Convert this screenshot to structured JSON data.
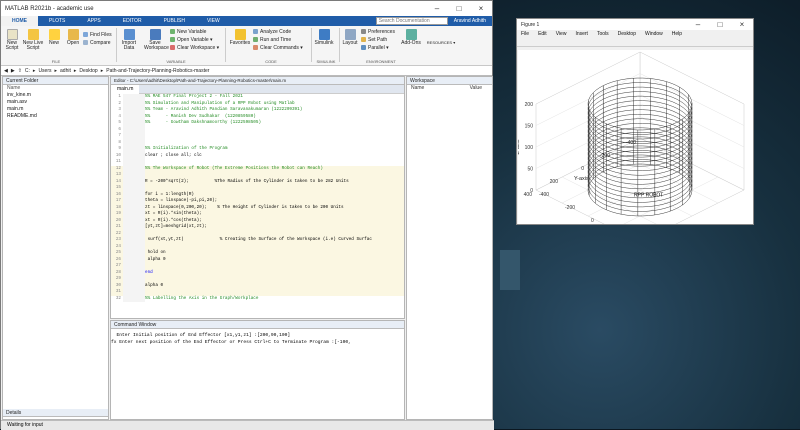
{
  "window": {
    "title": "MATLAB R2021b - academic use"
  },
  "ribbon_tabs": [
    "HOME",
    "PLOTS",
    "APPS",
    "EDITOR",
    "PUBLISH",
    "VIEW"
  ],
  "search": {
    "placeholder": "Search Documentation"
  },
  "user": "Aravind Adhith",
  "home": {
    "buttons": {
      "new_script": "New Script",
      "new_live_script": "New Live Script",
      "new": "New",
      "open": "Open",
      "find_files": "Find Files",
      "compare": "Compare",
      "import_data": "Import Data",
      "save_workspace": "Save Workspace",
      "new_variable": "New Variable",
      "open_variable": "Open Variable",
      "clear_workspace": "Clear Workspace",
      "favorites": "Favorites",
      "analyze_code": "Analyze Code",
      "run_and_time": "Run and Time",
      "clear_commands": "Clear Commands",
      "simulink": "Simulink",
      "layout": "Layout",
      "preferences": "Preferences",
      "set_path": "Set Path",
      "parallel": "Parallel",
      "add_ons": "Add-Ons",
      "resources": "RESOURCES"
    },
    "sections": {
      "file": "FILE",
      "variable": "VARIABLE",
      "code": "CODE",
      "simulink": "SIMULINK",
      "environment": "ENVIRONMENT"
    }
  },
  "address": {
    "parts": [
      "C:",
      "Users",
      "adhit",
      "Desktop",
      "Path-and-Trajectory-Planning-Robotics-master"
    ]
  },
  "current_folder": {
    "title": "Current Folder",
    "col": "Name",
    "files": [
      "inv_kine.m",
      "main.asv",
      "main.m",
      "README.md"
    ]
  },
  "details": "Details",
  "editor": {
    "title": "Editor - C:\\Users\\adhit\\Desktop\\Path-and-Trajectory-Planning-Robotics-master\\main.m",
    "tab": "main.m",
    "lines": [
      {
        "n": "1",
        "t": "%% MAE 547 Final Project 2 - Fall 2021",
        "c": "cm"
      },
      {
        "n": "2",
        "t": "%% Simulation and Manipulation of a RPP Robot using Matlab",
        "c": "cm"
      },
      {
        "n": "3",
        "t": "%% Team - Aravind Adhith Pandian Saravanakumaran (1222209391)",
        "c": "cm"
      },
      {
        "n": "4",
        "t": "%%      - Manish Dev Sudhakar  (1220859580)",
        "c": "cm"
      },
      {
        "n": "5",
        "t": "%%      - Gowtham Dakshnamoorthy (1222598505)",
        "c": "cm"
      },
      {
        "n": "6",
        "t": "",
        "c": "ct"
      },
      {
        "n": "7",
        "t": "",
        "c": "ct"
      },
      {
        "n": "8",
        "t": "",
        "c": "ct"
      },
      {
        "n": "9",
        "t": "%% Initialization of the Program",
        "c": "cm"
      },
      {
        "n": "10",
        "t": "clear ; close all; clc",
        "c": "ct"
      },
      {
        "n": "11",
        "t": "",
        "c": "ct"
      },
      {
        "n": "12",
        "t": "%% The Workspace of Robot (The Extreme Positions the Robot can Reach)",
        "c": "cm"
      },
      {
        "n": "13",
        "t": "",
        "c": "ct"
      },
      {
        "n": "14",
        "t": "R = -200*sqrt(2);          %The Radius of the Cylinder is taken to be 282 Units",
        "c": "ct"
      },
      {
        "n": "15",
        "t": "",
        "c": "ct"
      },
      {
        "n": "16",
        "t": "for i = 1:length(R)",
        "c": "ct"
      },
      {
        "n": "17",
        "t": "theta = linspace(-pi,pi,20);",
        "c": "ct"
      },
      {
        "n": "18",
        "t": "zt = linspace(0,200,20);    % The Height of Cylinder is taken to be 200 Units",
        "c": "ct"
      },
      {
        "n": "19",
        "t": "xt = R(i).*sin(theta);",
        "c": "ct"
      },
      {
        "n": "20",
        "t": "xt = R(i).*cos(theta);",
        "c": "ct"
      },
      {
        "n": "21",
        "t": "[yt,zt]=meshgrid(xt,zt);",
        "c": "ct"
      },
      {
        "n": "22",
        "t": "",
        "c": "ct"
      },
      {
        "n": "23",
        "t": " surf(xt,yt,zt)              % Creating the Surface of the Workspace (i.e) Curved Surfac",
        "c": "ct"
      },
      {
        "n": "24",
        "t": "",
        "c": "ct"
      },
      {
        "n": "25",
        "t": " hold on",
        "c": "ct"
      },
      {
        "n": "26",
        "t": " alpha 0",
        "c": "ct"
      },
      {
        "n": "27",
        "t": "",
        "c": "ct"
      },
      {
        "n": "28",
        "t": "end",
        "c": "kw"
      },
      {
        "n": "29",
        "t": "",
        "c": "ct"
      },
      {
        "n": "30",
        "t": "alpha 0",
        "c": "ct"
      },
      {
        "n": "31",
        "t": "",
        "c": "ct"
      },
      {
        "n": "32",
        "t": "%% Labelling the Axis in the Graph/Workplace",
        "c": "cm"
      }
    ]
  },
  "workspace": {
    "title": "Workspace",
    "name_col": "Name",
    "value_col": "Value"
  },
  "command_window": {
    "title": "Command Window",
    "lines": [
      "  Enter Initial position of End Effector [x1,y1,z1] :[200,90,100]",
      "fx Enter next position of the End Effector or Press Ctrl+C to Terminate Program :[-100,"
    ]
  },
  "status": "Waiting for input",
  "figure": {
    "title": "Figure 1",
    "menu": [
      "File",
      "Edit",
      "View",
      "Insert",
      "Tools",
      "Desktop",
      "Window",
      "Help"
    ],
    "annotation": "RPP ROBOT"
  },
  "chart_data": {
    "type": "surface",
    "title": "",
    "xlabel": "X-axis",
    "ylabel": "Y-axis",
    "zlabel": "Z-axis",
    "xlim": [
      -400,
      400
    ],
    "ylim": [
      -400,
      400
    ],
    "zlim": [
      0,
      200
    ],
    "x_ticks": [
      "-400",
      "-200",
      "0",
      "200",
      "400"
    ],
    "y_ticks": [
      "-400",
      "-200",
      "0",
      "200",
      "400"
    ],
    "z_ticks": [
      "0",
      "50",
      "100",
      "150",
      "200"
    ],
    "surface": {
      "shape": "cylinder",
      "radius": 282.8,
      "height": 200,
      "n_theta": 20,
      "n_z": 20
    },
    "annotation": "RPP ROBOT"
  }
}
